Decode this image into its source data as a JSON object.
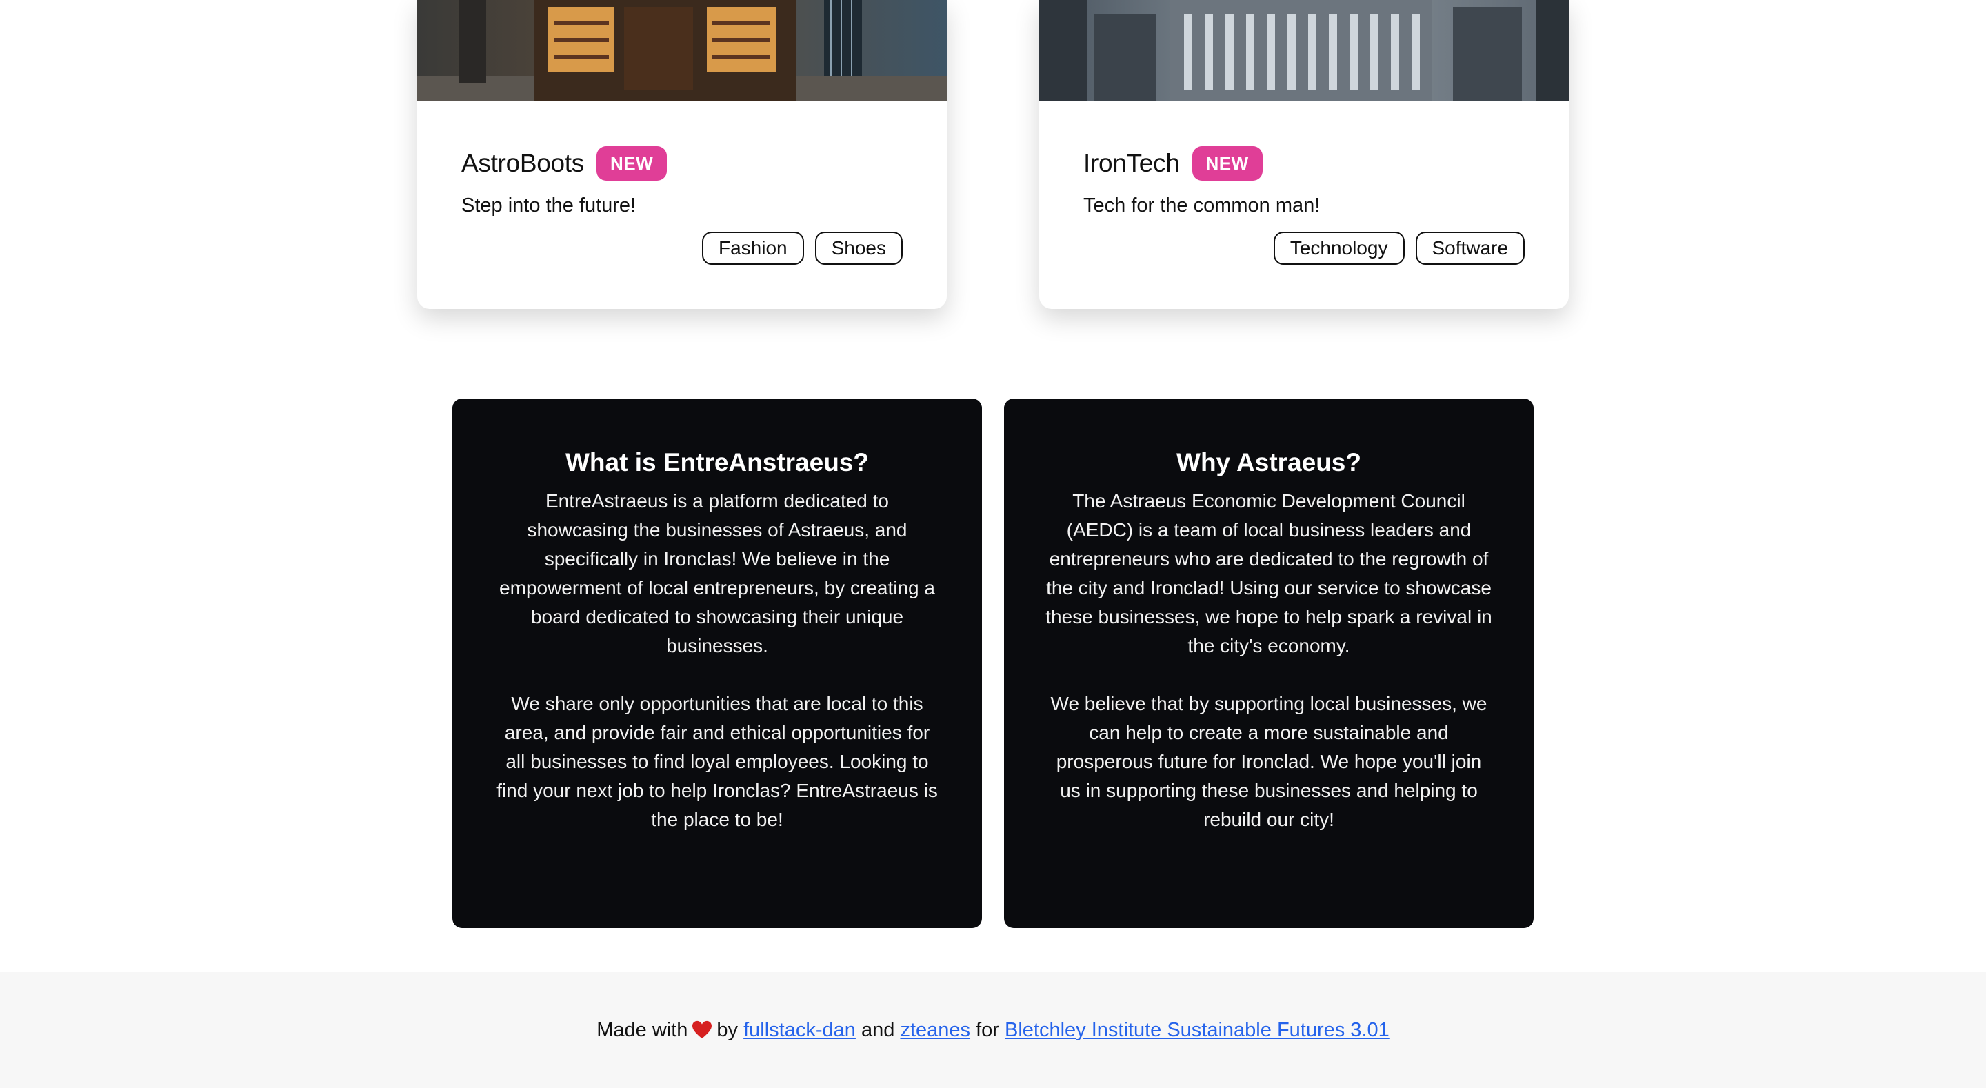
{
  "cards": [
    {
      "name": "AstroBoots",
      "badge": "NEW",
      "description": "Step into the future!",
      "tags": [
        "Fashion",
        "Shoes"
      ]
    },
    {
      "name": "IronTech",
      "badge": "NEW",
      "description": "Tech for the common man!",
      "tags": [
        "Technology",
        "Software"
      ]
    }
  ],
  "panels": [
    {
      "title": "What is EntreAnstraeus?",
      "paragraphs": [
        "EntreAstraeus is a platform dedicated to showcasing the businesses of Astraeus, and specifically in Ironclas! We believe in the empowerment of local entrepreneurs, by creating a board dedicated to showcasing their unique businesses.",
        "We share only opportunities that are local to this area, and provide fair and ethical opportunities for all businesses to find loyal employees. Looking to find your next job to help Ironclas? EntreAstraeus is the place to be!"
      ]
    },
    {
      "title": "Why Astraeus?",
      "paragraphs": [
        "The Astraeus Economic Development Council (AEDC) is a team of local business leaders and entrepreneurs who are dedicated to the regrowth of the city and Ironclad! Using our service to showcase these businesses, we hope to help spark a revival in the city's economy.",
        "We believe that by supporting local businesses, we can help to create a more sustainable and prosperous future for Ironclad. We hope you'll join us in supporting these businesses and helping to rebuild our city!"
      ]
    }
  ],
  "footer": {
    "made_with": "Made with",
    "by": "by",
    "author1": "fullstack-dan",
    "and": "and",
    "author2": "zteanes",
    "for": "for",
    "event": "Bletchley Institute Sustainable Futures 3.01"
  },
  "colors": {
    "badge": "#e03e97",
    "panel_bg": "#0a0b0e",
    "link": "#2563eb",
    "footer_bg": "#f7f7f7"
  },
  "icons": {
    "heart": "heart-icon"
  }
}
